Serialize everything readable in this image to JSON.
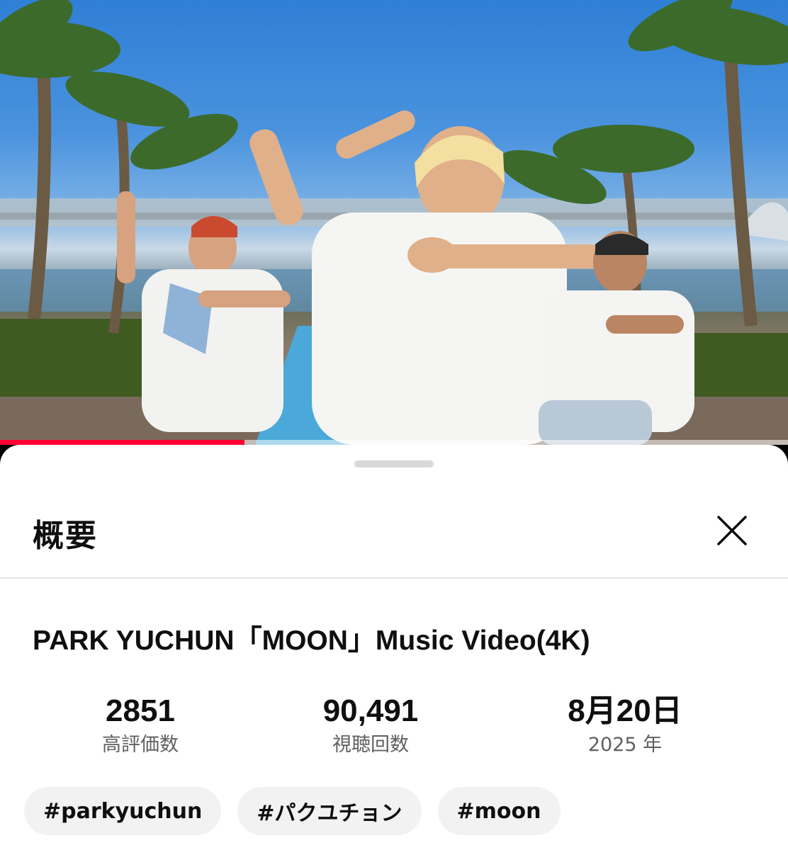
{
  "video": {
    "progress_fraction": 0.31,
    "accent_color": "#ff0033"
  },
  "sheet": {
    "title": "概要",
    "close_icon": "close-icon"
  },
  "details": {
    "video_title": "PARK YUCHUN「MOON」Music Video(4K)",
    "stats": [
      {
        "value": "2851",
        "label": "高評価数"
      },
      {
        "value": "90,491",
        "label": "視聴回数"
      },
      {
        "value": "8月20日",
        "label": "2025 年"
      }
    ],
    "tags": [
      "#parkyuchun",
      "#パクユチョン",
      "#moon"
    ]
  }
}
